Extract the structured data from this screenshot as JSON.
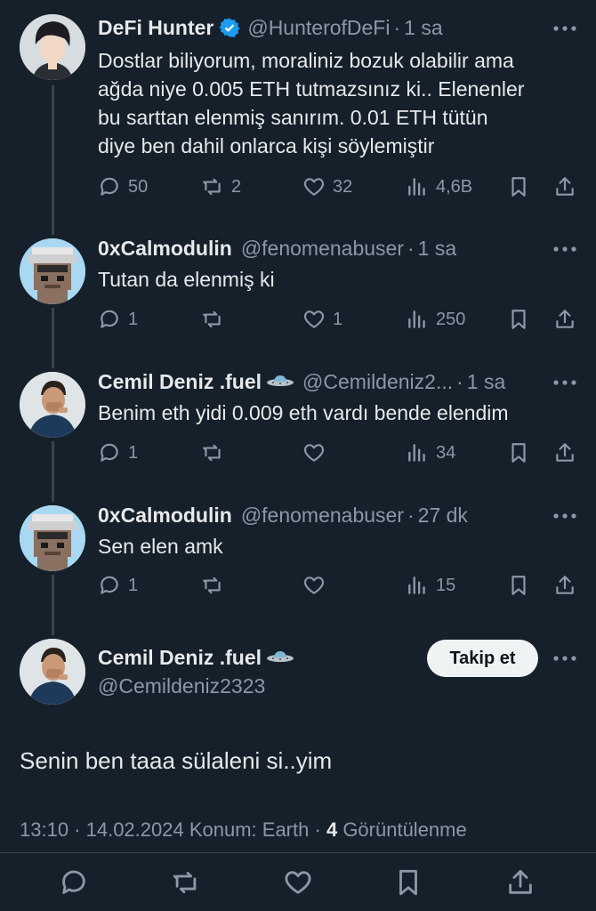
{
  "tweets": [
    {
      "name": "DeFi Hunter",
      "handle": "@HunterofDeFi",
      "time": "1 sa",
      "verified": true,
      "text_lines": [
        "Dostlar biliyorum, moraliniz bozuk olabilir ama",
        "ağda niye 0.005 ETH tutmazsınız ki.. Elenenler",
        "bu sarttan elenmiş sanırım. 0.01 ETH tütün",
        "diye ben dahil onlarca kişi söylemiştir"
      ],
      "replies": "50",
      "retweets": "2",
      "likes": "32",
      "views": "4,6B"
    },
    {
      "name": "0xCalmodulin",
      "handle": "@fenomenabuser",
      "time": "1 sa",
      "text_lines": [
        "Tutan da elenmiş ki"
      ],
      "replies": "1",
      "retweets": "",
      "likes": "1",
      "views": "250"
    },
    {
      "name": "Cemil Deniz .fuel",
      "handle": "@Cemildeniz2...",
      "time": "1 sa",
      "text_lines": [
        "Benim eth yidi 0.009 eth vardı bende elendim"
      ],
      "replies": "1",
      "retweets": "",
      "likes": "",
      "views": "34"
    },
    {
      "name": "0xCalmodulin",
      "handle": "@fenomenabuser",
      "time": "27 dk",
      "text_lines": [
        "Sen elen amk"
      ],
      "replies": "1",
      "retweets": "",
      "likes": "",
      "views": "15"
    }
  ],
  "main_tweet": {
    "name": "Cemil Deniz .fuel",
    "handle": "@Cemildeniz2323",
    "follow_label": "Takip et",
    "text": "Senin ben taaa sülaleni si..yim",
    "timestamp": "13:10 · 14.02.2024",
    "location": "Konum: Earth",
    "views_count": "4",
    "views_label": "Görüntülenme"
  },
  "separator": "·",
  "colors": {
    "background": "#15202b",
    "text": "#e7e9ea",
    "muted": "#8b98a5",
    "verified": "#1d9bf0"
  }
}
